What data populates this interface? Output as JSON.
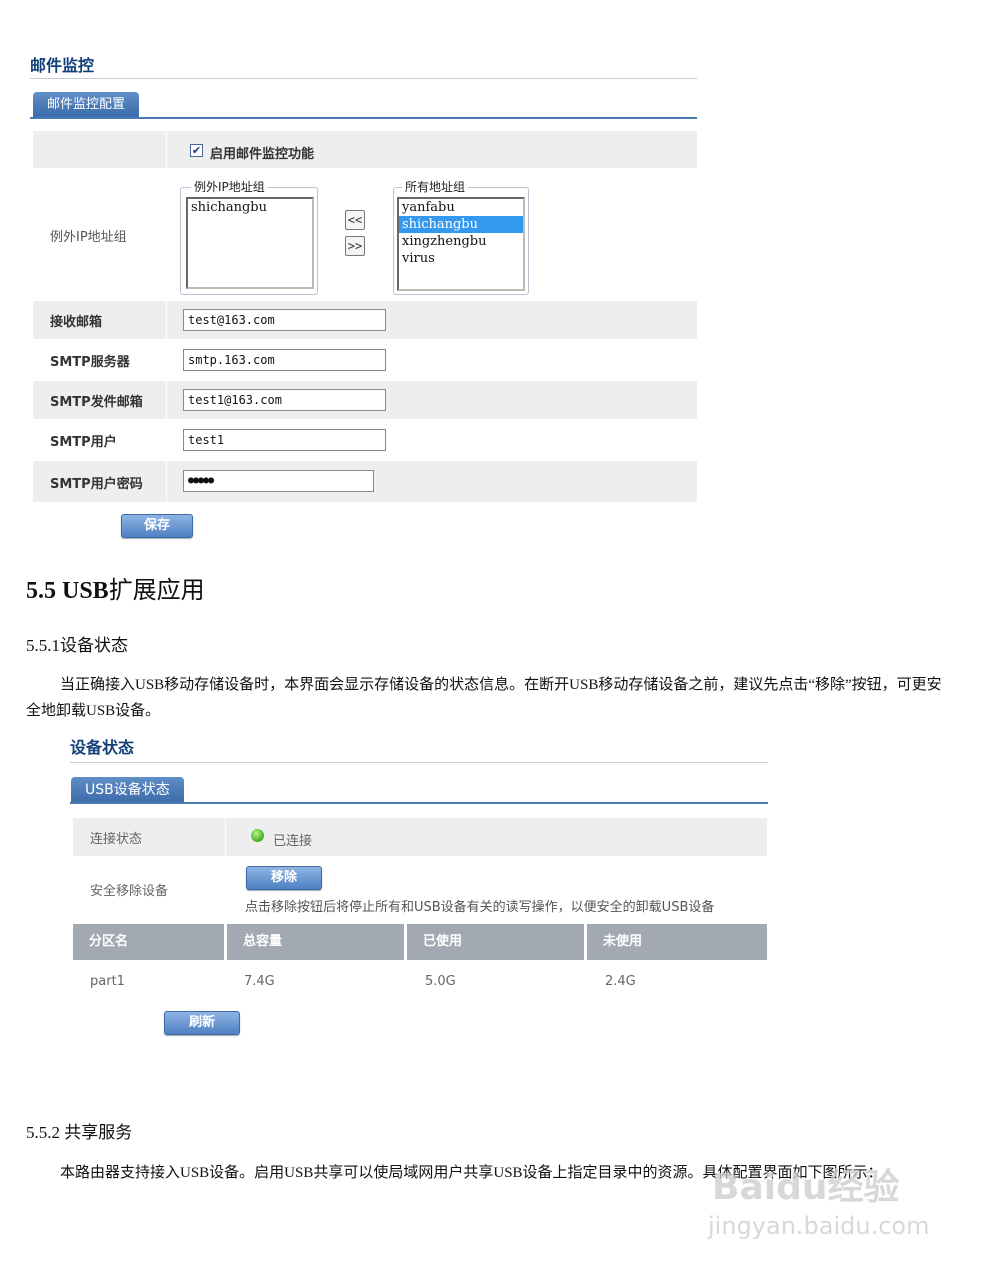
{
  "mail_panel": {
    "title": "邮件监控",
    "tab": "邮件监控配置",
    "enable_label": "启用邮件监控功能",
    "enable_checked": true,
    "exception_group_label": "例外IP地址组",
    "exception_box_legend": "例外IP地址组",
    "exception_items": [
      "shichangbu"
    ],
    "all_box_legend": "所有地址组",
    "all_items": [
      "yanfabu",
      "shichangbu",
      "xingzhengbu",
      "virus"
    ],
    "selected_index": 1,
    "move_left": "<<",
    "move_right": ">>",
    "fields": [
      {
        "label": "接收邮箱",
        "value": "test@163.com"
      },
      {
        "label": "SMTP服务器",
        "value": "smtp.163.com"
      },
      {
        "label": "SMTP发件邮箱",
        "value": "test1@163.com"
      },
      {
        "label": "SMTP用户",
        "value": "test1"
      },
      {
        "label": "SMTP用户密码",
        "value": "●●●●●"
      }
    ],
    "save_label": "保存"
  },
  "doc": {
    "h2_bold": "5.5 USB",
    "h2_rest": "扩展应用",
    "h3_1": "5.5.1设备状态",
    "para_1": "当正确接入USB移动存储设备时，本界面会显示存储设备的状态信息。在断开USB移动存储设备之前，建议先点击“移除”按钮，可更安全地卸载USB设备。",
    "h3_2": "5.5.2 共享服务",
    "para_2": "本路由器支持接入USB设备。启用USB共享可以使局域网用户共享USB设备上指定目录中的资源。具体配置界面如下图所示："
  },
  "usb_panel": {
    "title": "设备状态",
    "tab": "USB设备状态",
    "conn_label": "连接状态",
    "conn_value": "已连接",
    "remove_label": "安全移除设备",
    "remove_button": "移除",
    "remove_hint": "点击移除按钮后将停止所有和USB设备有关的读写操作，以便安全的卸载USB设备",
    "headers": [
      "分区名",
      "总容量",
      "已使用",
      "未使用"
    ],
    "rows": [
      [
        "part1",
        "7.4G",
        "5.0G",
        "2.4G"
      ]
    ],
    "refresh_button": "刷新"
  },
  "watermark": {
    "logo": "Baidu经验",
    "url": "jingyan.baidu.com"
  }
}
